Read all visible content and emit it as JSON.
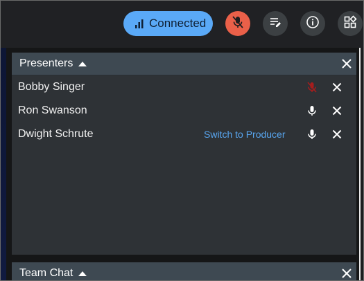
{
  "toolbar": {
    "connection_label": "Connected",
    "icons": [
      "signal-icon",
      "mic-off-icon",
      "notes-icon",
      "info-icon",
      "apps-icon"
    ],
    "colors": {
      "connected_bg": "#5aa9f7",
      "mic_off_bg": "#ea6049",
      "button_bg": "#3c4043"
    }
  },
  "presenters_panel": {
    "title": "Presenters",
    "rows": [
      {
        "name": "Bobby Singer",
        "action": "",
        "mic": "muted"
      },
      {
        "name": "Ron Swanson",
        "action": "",
        "mic": "on"
      },
      {
        "name": "Dwight Schrute",
        "action": "Switch to Producer",
        "mic": "on"
      }
    ]
  },
  "chat_panel": {
    "title": "Team Chat"
  }
}
